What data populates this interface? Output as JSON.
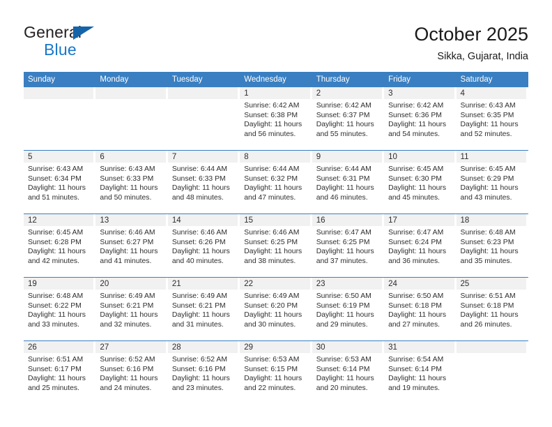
{
  "brand": {
    "name_top": "General",
    "name_bottom": "Blue",
    "triangle_color": "#1464aa",
    "blue_color": "#1877c9"
  },
  "header": {
    "title": "October 2025",
    "subtitle": "Sikka, Gujarat, India"
  },
  "theme": {
    "header_bar_color": "#3a7fc1",
    "daynum_band_color": "#f1f1f1",
    "row_divider_color": "#3a7fc1",
    "text_color": "#2d2d2d"
  },
  "weekdays": [
    "Sunday",
    "Monday",
    "Tuesday",
    "Wednesday",
    "Thursday",
    "Friday",
    "Saturday"
  ],
  "labels": {
    "sunrise_prefix": "Sunrise:",
    "sunset_prefix": "Sunset:",
    "daylight_prefix": "Daylight:"
  },
  "weeks": [
    [
      {
        "day": "",
        "empty": true,
        "line1": "",
        "line2": "",
        "line3": "",
        "line4": ""
      },
      {
        "day": "",
        "empty": true,
        "line1": "",
        "line2": "",
        "line3": "",
        "line4": ""
      },
      {
        "day": "",
        "empty": true,
        "line1": "",
        "line2": "",
        "line3": "",
        "line4": ""
      },
      {
        "day": "1",
        "sunrise": "6:42 AM",
        "sunset": "6:38 PM",
        "daylight_hours": 11,
        "daylight_minutes": 56,
        "line1": "Sunrise: 6:42 AM",
        "line2": "Sunset: 6:38 PM",
        "line3": "Daylight: 11 hours",
        "line4": "and 56 minutes."
      },
      {
        "day": "2",
        "sunrise": "6:42 AM",
        "sunset": "6:37 PM",
        "daylight_hours": 11,
        "daylight_minutes": 55,
        "line1": "Sunrise: 6:42 AM",
        "line2": "Sunset: 6:37 PM",
        "line3": "Daylight: 11 hours",
        "line4": "and 55 minutes."
      },
      {
        "day": "3",
        "sunrise": "6:42 AM",
        "sunset": "6:36 PM",
        "daylight_hours": 11,
        "daylight_minutes": 54,
        "line1": "Sunrise: 6:42 AM",
        "line2": "Sunset: 6:36 PM",
        "line3": "Daylight: 11 hours",
        "line4": "and 54 minutes."
      },
      {
        "day": "4",
        "sunrise": "6:43 AM",
        "sunset": "6:35 PM",
        "daylight_hours": 11,
        "daylight_minutes": 52,
        "line1": "Sunrise: 6:43 AM",
        "line2": "Sunset: 6:35 PM",
        "line3": "Daylight: 11 hours",
        "line4": "and 52 minutes."
      }
    ],
    [
      {
        "day": "5",
        "sunrise": "6:43 AM",
        "sunset": "6:34 PM",
        "daylight_hours": 11,
        "daylight_minutes": 51,
        "line1": "Sunrise: 6:43 AM",
        "line2": "Sunset: 6:34 PM",
        "line3": "Daylight: 11 hours",
        "line4": "and 51 minutes."
      },
      {
        "day": "6",
        "sunrise": "6:43 AM",
        "sunset": "6:33 PM",
        "daylight_hours": 11,
        "daylight_minutes": 50,
        "line1": "Sunrise: 6:43 AM",
        "line2": "Sunset: 6:33 PM",
        "line3": "Daylight: 11 hours",
        "line4": "and 50 minutes."
      },
      {
        "day": "7",
        "sunrise": "6:44 AM",
        "sunset": "6:33 PM",
        "daylight_hours": 11,
        "daylight_minutes": 48,
        "line1": "Sunrise: 6:44 AM",
        "line2": "Sunset: 6:33 PM",
        "line3": "Daylight: 11 hours",
        "line4": "and 48 minutes."
      },
      {
        "day": "8",
        "sunrise": "6:44 AM",
        "sunset": "6:32 PM",
        "daylight_hours": 11,
        "daylight_minutes": 47,
        "line1": "Sunrise: 6:44 AM",
        "line2": "Sunset: 6:32 PM",
        "line3": "Daylight: 11 hours",
        "line4": "and 47 minutes."
      },
      {
        "day": "9",
        "sunrise": "6:44 AM",
        "sunset": "6:31 PM",
        "daylight_hours": 11,
        "daylight_minutes": 46,
        "line1": "Sunrise: 6:44 AM",
        "line2": "Sunset: 6:31 PM",
        "line3": "Daylight: 11 hours",
        "line4": "and 46 minutes."
      },
      {
        "day": "10",
        "sunrise": "6:45 AM",
        "sunset": "6:30 PM",
        "daylight_hours": 11,
        "daylight_minutes": 45,
        "line1": "Sunrise: 6:45 AM",
        "line2": "Sunset: 6:30 PM",
        "line3": "Daylight: 11 hours",
        "line4": "and 45 minutes."
      },
      {
        "day": "11",
        "sunrise": "6:45 AM",
        "sunset": "6:29 PM",
        "daylight_hours": 11,
        "daylight_minutes": 43,
        "line1": "Sunrise: 6:45 AM",
        "line2": "Sunset: 6:29 PM",
        "line3": "Daylight: 11 hours",
        "line4": "and 43 minutes."
      }
    ],
    [
      {
        "day": "12",
        "sunrise": "6:45 AM",
        "sunset": "6:28 PM",
        "daylight_hours": 11,
        "daylight_minutes": 42,
        "line1": "Sunrise: 6:45 AM",
        "line2": "Sunset: 6:28 PM",
        "line3": "Daylight: 11 hours",
        "line4": "and 42 minutes."
      },
      {
        "day": "13",
        "sunrise": "6:46 AM",
        "sunset": "6:27 PM",
        "daylight_hours": 11,
        "daylight_minutes": 41,
        "line1": "Sunrise: 6:46 AM",
        "line2": "Sunset: 6:27 PM",
        "line3": "Daylight: 11 hours",
        "line4": "and 41 minutes."
      },
      {
        "day": "14",
        "sunrise": "6:46 AM",
        "sunset": "6:26 PM",
        "daylight_hours": 11,
        "daylight_minutes": 40,
        "line1": "Sunrise: 6:46 AM",
        "line2": "Sunset: 6:26 PM",
        "line3": "Daylight: 11 hours",
        "line4": "and 40 minutes."
      },
      {
        "day": "15",
        "sunrise": "6:46 AM",
        "sunset": "6:25 PM",
        "daylight_hours": 11,
        "daylight_minutes": 38,
        "line1": "Sunrise: 6:46 AM",
        "line2": "Sunset: 6:25 PM",
        "line3": "Daylight: 11 hours",
        "line4": "and 38 minutes."
      },
      {
        "day": "16",
        "sunrise": "6:47 AM",
        "sunset": "6:25 PM",
        "daylight_hours": 11,
        "daylight_minutes": 37,
        "line1": "Sunrise: 6:47 AM",
        "line2": "Sunset: 6:25 PM",
        "line3": "Daylight: 11 hours",
        "line4": "and 37 minutes."
      },
      {
        "day": "17",
        "sunrise": "6:47 AM",
        "sunset": "6:24 PM",
        "daylight_hours": 11,
        "daylight_minutes": 36,
        "line1": "Sunrise: 6:47 AM",
        "line2": "Sunset: 6:24 PM",
        "line3": "Daylight: 11 hours",
        "line4": "and 36 minutes."
      },
      {
        "day": "18",
        "sunrise": "6:48 AM",
        "sunset": "6:23 PM",
        "daylight_hours": 11,
        "daylight_minutes": 35,
        "line1": "Sunrise: 6:48 AM",
        "line2": "Sunset: 6:23 PM",
        "line3": "Daylight: 11 hours",
        "line4": "and 35 minutes."
      }
    ],
    [
      {
        "day": "19",
        "sunrise": "6:48 AM",
        "sunset": "6:22 PM",
        "daylight_hours": 11,
        "daylight_minutes": 33,
        "line1": "Sunrise: 6:48 AM",
        "line2": "Sunset: 6:22 PM",
        "line3": "Daylight: 11 hours",
        "line4": "and 33 minutes."
      },
      {
        "day": "20",
        "sunrise": "6:49 AM",
        "sunset": "6:21 PM",
        "daylight_hours": 11,
        "daylight_minutes": 32,
        "line1": "Sunrise: 6:49 AM",
        "line2": "Sunset: 6:21 PM",
        "line3": "Daylight: 11 hours",
        "line4": "and 32 minutes."
      },
      {
        "day": "21",
        "sunrise": "6:49 AM",
        "sunset": "6:21 PM",
        "daylight_hours": 11,
        "daylight_minutes": 31,
        "line1": "Sunrise: 6:49 AM",
        "line2": "Sunset: 6:21 PM",
        "line3": "Daylight: 11 hours",
        "line4": "and 31 minutes."
      },
      {
        "day": "22",
        "sunrise": "6:49 AM",
        "sunset": "6:20 PM",
        "daylight_hours": 11,
        "daylight_minutes": 30,
        "line1": "Sunrise: 6:49 AM",
        "line2": "Sunset: 6:20 PM",
        "line3": "Daylight: 11 hours",
        "line4": "and 30 minutes."
      },
      {
        "day": "23",
        "sunrise": "6:50 AM",
        "sunset": "6:19 PM",
        "daylight_hours": 11,
        "daylight_minutes": 29,
        "line1": "Sunrise: 6:50 AM",
        "line2": "Sunset: 6:19 PM",
        "line3": "Daylight: 11 hours",
        "line4": "and 29 minutes."
      },
      {
        "day": "24",
        "sunrise": "6:50 AM",
        "sunset": "6:18 PM",
        "daylight_hours": 11,
        "daylight_minutes": 27,
        "line1": "Sunrise: 6:50 AM",
        "line2": "Sunset: 6:18 PM",
        "line3": "Daylight: 11 hours",
        "line4": "and 27 minutes."
      },
      {
        "day": "25",
        "sunrise": "6:51 AM",
        "sunset": "6:18 PM",
        "daylight_hours": 11,
        "daylight_minutes": 26,
        "line1": "Sunrise: 6:51 AM",
        "line2": "Sunset: 6:18 PM",
        "line3": "Daylight: 11 hours",
        "line4": "and 26 minutes."
      }
    ],
    [
      {
        "day": "26",
        "sunrise": "6:51 AM",
        "sunset": "6:17 PM",
        "daylight_hours": 11,
        "daylight_minutes": 25,
        "line1": "Sunrise: 6:51 AM",
        "line2": "Sunset: 6:17 PM",
        "line3": "Daylight: 11 hours",
        "line4": "and 25 minutes."
      },
      {
        "day": "27",
        "sunrise": "6:52 AM",
        "sunset": "6:16 PM",
        "daylight_hours": 11,
        "daylight_minutes": 24,
        "line1": "Sunrise: 6:52 AM",
        "line2": "Sunset: 6:16 PM",
        "line3": "Daylight: 11 hours",
        "line4": "and 24 minutes."
      },
      {
        "day": "28",
        "sunrise": "6:52 AM",
        "sunset": "6:16 PM",
        "daylight_hours": 11,
        "daylight_minutes": 23,
        "line1": "Sunrise: 6:52 AM",
        "line2": "Sunset: 6:16 PM",
        "line3": "Daylight: 11 hours",
        "line4": "and 23 minutes."
      },
      {
        "day": "29",
        "sunrise": "6:53 AM",
        "sunset": "6:15 PM",
        "daylight_hours": 11,
        "daylight_minutes": 22,
        "line1": "Sunrise: 6:53 AM",
        "line2": "Sunset: 6:15 PM",
        "line3": "Daylight: 11 hours",
        "line4": "and 22 minutes."
      },
      {
        "day": "30",
        "sunrise": "6:53 AM",
        "sunset": "6:14 PM",
        "daylight_hours": 11,
        "daylight_minutes": 20,
        "line1": "Sunrise: 6:53 AM",
        "line2": "Sunset: 6:14 PM",
        "line3": "Daylight: 11 hours",
        "line4": "and 20 minutes."
      },
      {
        "day": "31",
        "sunrise": "6:54 AM",
        "sunset": "6:14 PM",
        "daylight_hours": 11,
        "daylight_minutes": 19,
        "line1": "Sunrise: 6:54 AM",
        "line2": "Sunset: 6:14 PM",
        "line3": "Daylight: 11 hours",
        "line4": "and 19 minutes."
      },
      {
        "day": "",
        "empty": true,
        "line1": "",
        "line2": "",
        "line3": "",
        "line4": ""
      }
    ]
  ]
}
